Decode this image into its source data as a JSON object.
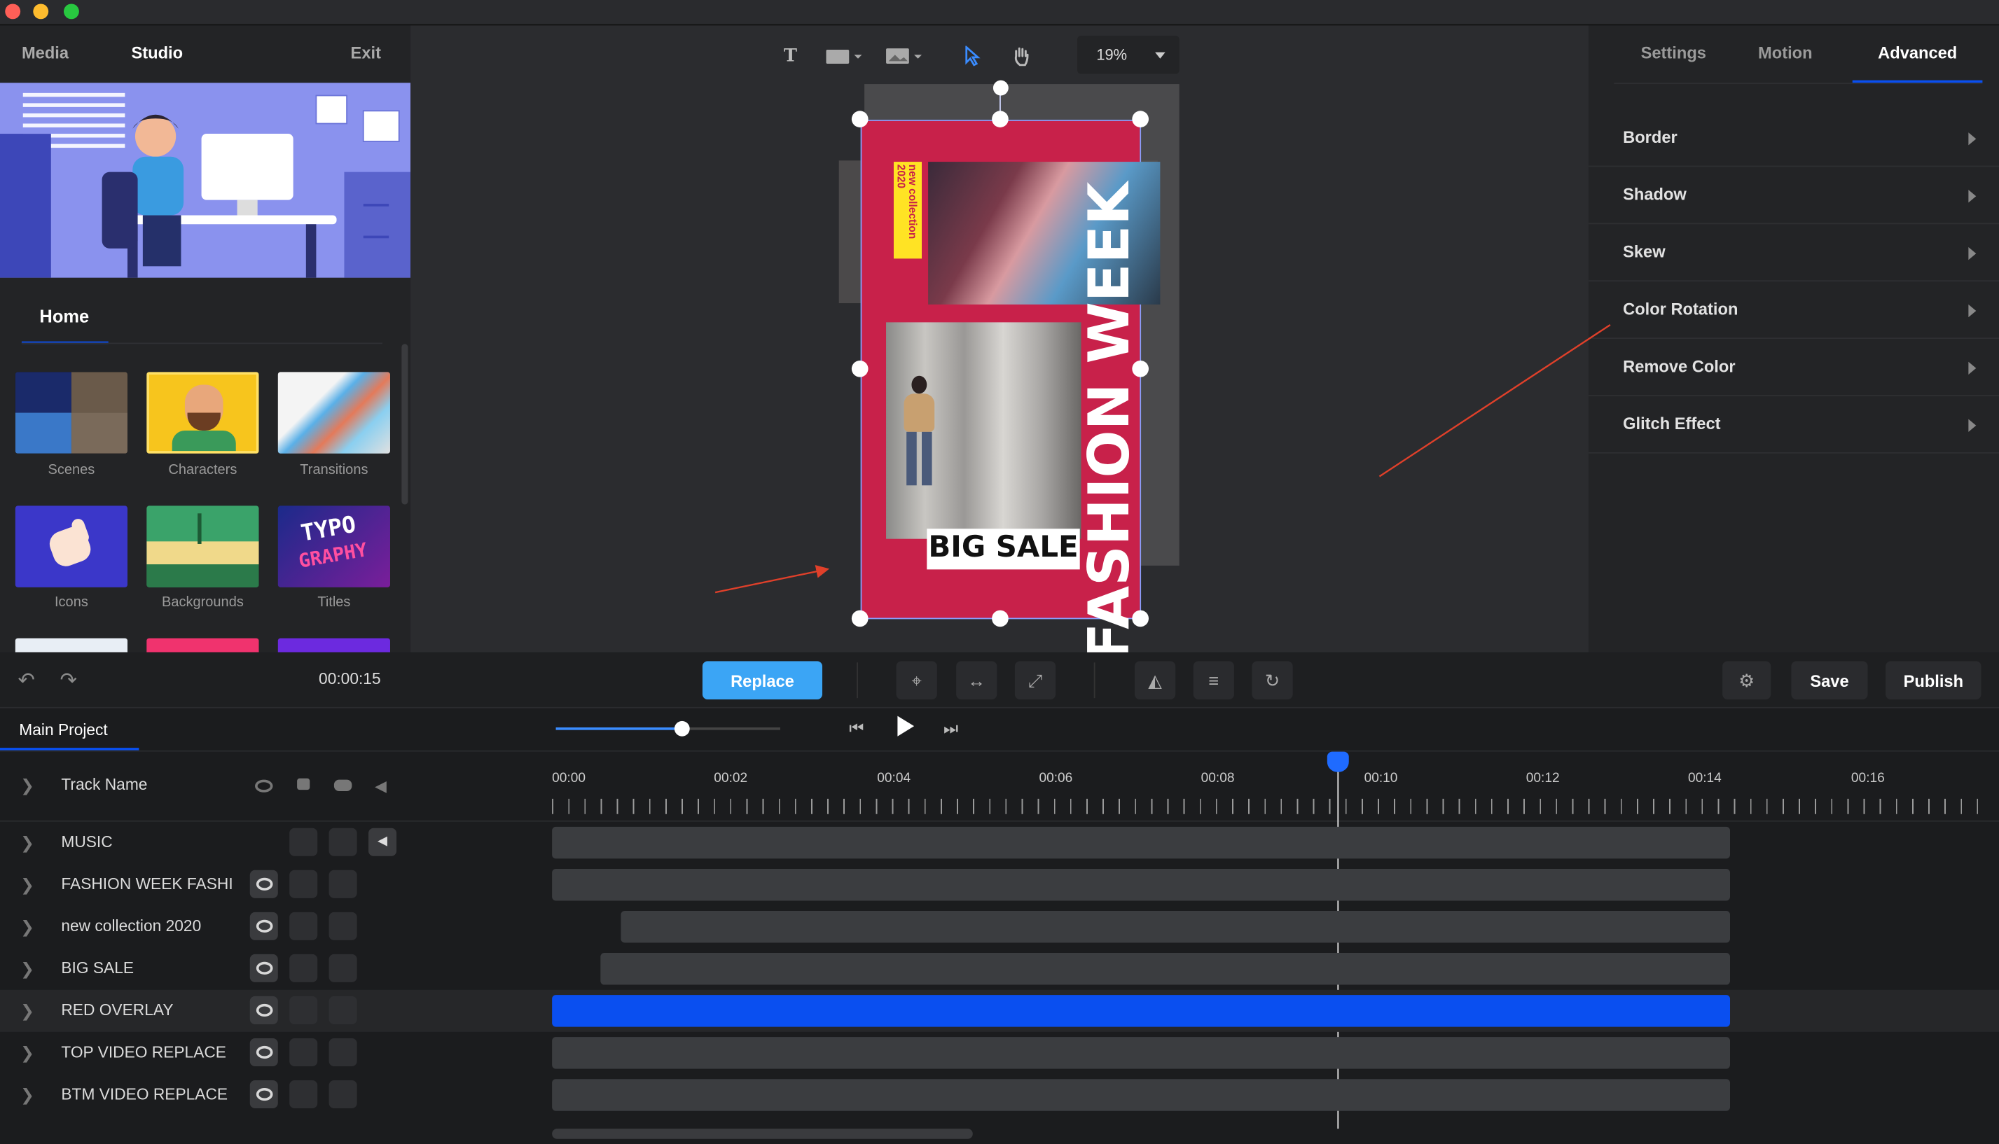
{
  "left_panel": {
    "tabs": [
      "Media",
      "Studio",
      "Exit"
    ],
    "home_label": "Home",
    "categories": [
      "Scenes",
      "Characters",
      "Transitions",
      "Icons",
      "Backgrounds",
      "Titles"
    ]
  },
  "toolbar": {
    "zoom": "19%"
  },
  "canvas": {
    "title_text": "FASHION WEEK",
    "sub_text": "new collection 2020",
    "sale_text": "BIG SALE",
    "overlay_color": "#c8214a"
  },
  "right_panel": {
    "tabs": [
      "Settings",
      "Motion",
      "Advanced"
    ],
    "active_tab": "Advanced",
    "rows": [
      "Border",
      "Shadow",
      "Skew",
      "Color Rotation",
      "Remove Color",
      "Glitch Effect"
    ]
  },
  "bottom_bar": {
    "time": "00:00:15",
    "replace_label": "Replace",
    "save_label": "Save",
    "publish_label": "Publish"
  },
  "timeline": {
    "project_tab": "Main Project",
    "header_label": "Track Name",
    "ruler": [
      "00:00",
      "00:02",
      "00:04",
      "00:06",
      "00:08",
      "00:10",
      "00:12",
      "00:14",
      "00:16"
    ],
    "tracks": [
      "MUSIC",
      "FASHION WEEK FASHI",
      "new collection 2020",
      "BIG SALE",
      "RED OVERLAY",
      "TOP VIDEO REPLACE",
      "BTM VIDEO REPLACE"
    ],
    "selected_track": "RED OVERLAY",
    "accent_color": "#0a4ff0"
  }
}
